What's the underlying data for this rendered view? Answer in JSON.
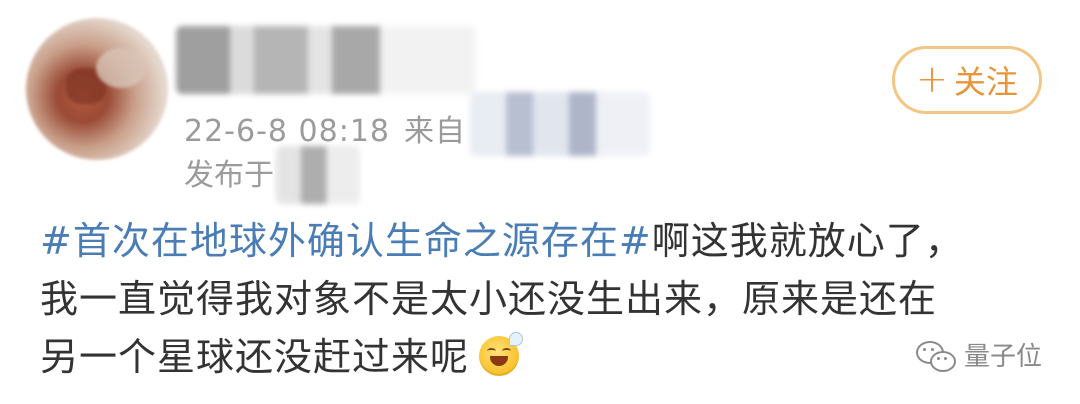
{
  "post": {
    "timestamp": "22-6-8 08:18",
    "source_prefix": "来自",
    "location_prefix": "发布于",
    "follow_label": "关注",
    "body": {
      "topic": "#首次在地球外确认生命之源存在#",
      "line1_rest": "啊这我就放心了，",
      "line2": "我一直觉得我对象不是太小还没生出来，原来是还在",
      "line3": "另一个星球还没赶过来呢"
    },
    "emoji": "sweat-smile-emoji"
  },
  "watermark": {
    "label": "量子位",
    "icon": "wechat-icon"
  },
  "colors": {
    "topic": "#4a7cb5",
    "follow_border": "#f3c686",
    "follow_text": "#e8953a",
    "meta_text": "#9b9b9b",
    "body_text": "#333333"
  }
}
